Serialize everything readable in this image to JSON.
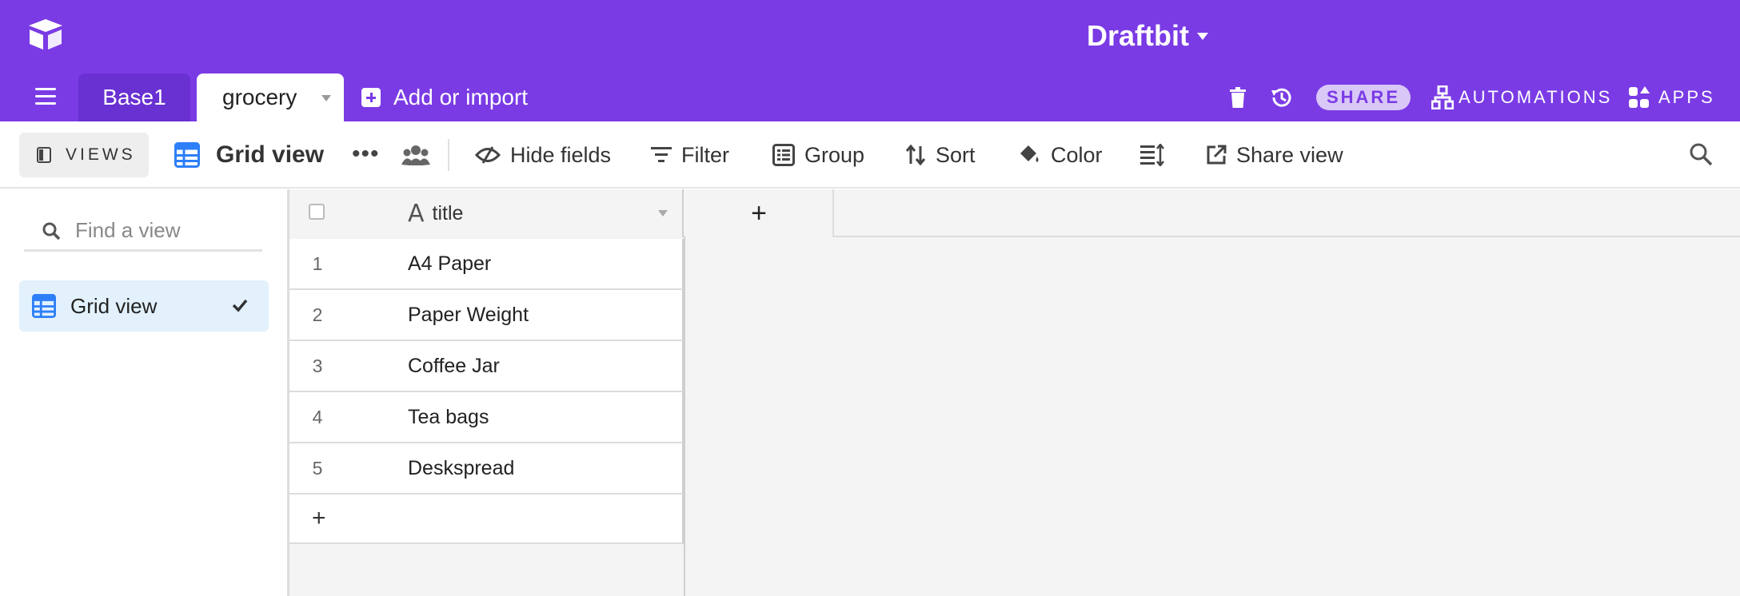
{
  "header": {
    "base_name": "Draftbit",
    "colors": {
      "brand": "#7a3be5",
      "tab_inactive": "#6930d2",
      "share_pill": "#d9c8f7",
      "selected_view": "#e2f1fb",
      "grid_icon": "#2d7ff9"
    }
  },
  "tabs": [
    {
      "label": "Base1",
      "active": false
    },
    {
      "label": "grocery",
      "active": true
    }
  ],
  "add_import_label": "Add or import",
  "top_actions": {
    "share": "SHARE",
    "automations": "AUTOMATIONS",
    "apps": "APPS"
  },
  "viewbar": {
    "views_label": "VIEWS",
    "current_view": "Grid view",
    "hide_fields": "Hide fields",
    "filter": "Filter",
    "group": "Group",
    "sort": "Sort",
    "color": "Color",
    "share_view": "Share view"
  },
  "sidebar": {
    "search_placeholder": "Find a view",
    "views": [
      {
        "label": "Grid view",
        "selected": true
      }
    ]
  },
  "grid": {
    "field_name": "title",
    "field_type_icon": "A",
    "add_field_label": "+",
    "add_row_label": "+",
    "rows": [
      {
        "num": "1",
        "title": "A4 Paper"
      },
      {
        "num": "2",
        "title": "Paper Weight"
      },
      {
        "num": "3",
        "title": "Coffee Jar"
      },
      {
        "num": "4",
        "title": "Tea bags"
      },
      {
        "num": "5",
        "title": "Deskspread"
      }
    ]
  }
}
